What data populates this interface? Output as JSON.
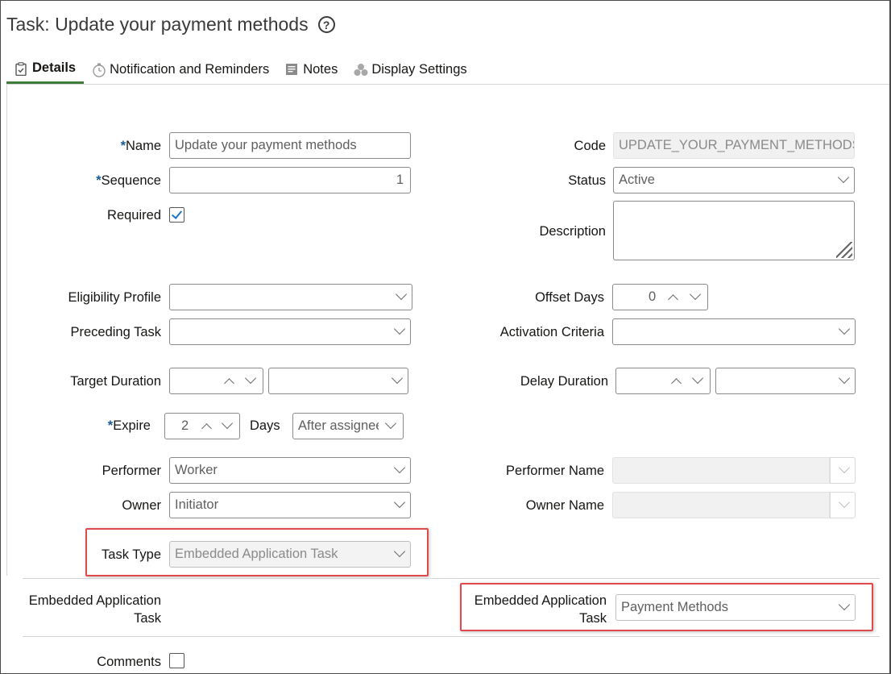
{
  "page": {
    "title": "Task: Update your payment methods"
  },
  "tabs": [
    {
      "label": "Details",
      "icon": "clipboard-check-icon"
    },
    {
      "label": "Notification and Reminders",
      "icon": "stopwatch-icon"
    },
    {
      "label": "Notes",
      "icon": "note-icon"
    },
    {
      "label": "Display Settings",
      "icon": "shapes-icon"
    }
  ],
  "form": {
    "name": {
      "label": "Name",
      "value": "Update your payment methods",
      "required": "*"
    },
    "sequence": {
      "label": "Sequence",
      "value": "1",
      "required": "*"
    },
    "required": {
      "label": "Required",
      "checked": true
    },
    "code": {
      "label": "Code",
      "value": "UPDATE_YOUR_PAYMENT_METHODS"
    },
    "status": {
      "label": "Status",
      "value": "Active"
    },
    "description": {
      "label": "Description",
      "value": ""
    },
    "eligibility_profile": {
      "label": "Eligibility Profile",
      "value": ""
    },
    "preceding_task": {
      "label": "Preceding Task",
      "value": ""
    },
    "offset_days": {
      "label": "Offset Days",
      "value": "0"
    },
    "activation_criteria": {
      "label": "Activation Criteria",
      "value": ""
    },
    "target_duration": {
      "label": "Target Duration",
      "value": "",
      "unit": ""
    },
    "delay_duration": {
      "label": "Delay Duration",
      "value": "",
      "unit": ""
    },
    "expire": {
      "label": "Expire",
      "value": "2",
      "required": "*",
      "days_label": "Days",
      "relative_to": "After assignee"
    },
    "performer": {
      "label": "Performer",
      "value": "Worker"
    },
    "performer_name": {
      "label": "Performer Name",
      "value": ""
    },
    "owner": {
      "label": "Owner",
      "value": "Initiator"
    },
    "owner_name": {
      "label": "Owner Name",
      "value": ""
    },
    "task_type": {
      "label": "Task Type",
      "value": "Embedded Application Task"
    },
    "section_heading": {
      "line1": "Embedded Application",
      "line2": "Task"
    },
    "embedded_task": {
      "label_line1": "Embedded Application",
      "label_line2": "Task",
      "value": "Payment Methods"
    },
    "comments": {
      "label": "Comments",
      "checked": false
    }
  },
  "colors": {
    "required_asterisk": "#1a5a94",
    "active_tab_underline": "#3f7d3d",
    "highlight_box": "#e04a4a",
    "checkbox_check": "#1a73c8"
  }
}
